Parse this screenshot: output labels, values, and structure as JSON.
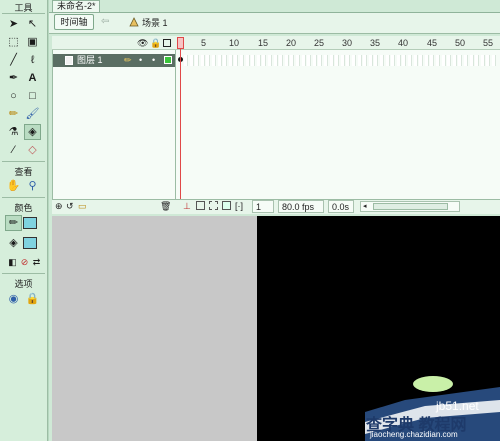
{
  "tools_panel": {
    "title": "工具",
    "view_label": "查看",
    "colors_label": "颜色",
    "options_label": "选项"
  },
  "document": {
    "tab_name": "未命名-2*",
    "timeline_button": "时间轴",
    "scene_label": "场景 1"
  },
  "timeline": {
    "ruler": [
      "1",
      "5",
      "10",
      "15",
      "20",
      "25",
      "30",
      "35",
      "40",
      "45",
      "50",
      "55"
    ],
    "layer_name": "图层 1",
    "current_frame": "1",
    "fps": "80.0 fps",
    "elapsed": "0.0s"
  },
  "watermark": {
    "site": "jb51.net",
    "text": "查字典 教程网",
    "url": "jiaocheng.chazidian.com"
  },
  "colors": {
    "panel_bg": "#d6eedb",
    "stage_bg": "#000000",
    "playhead": "#e04848",
    "layer_selected": "#5a6e63"
  }
}
